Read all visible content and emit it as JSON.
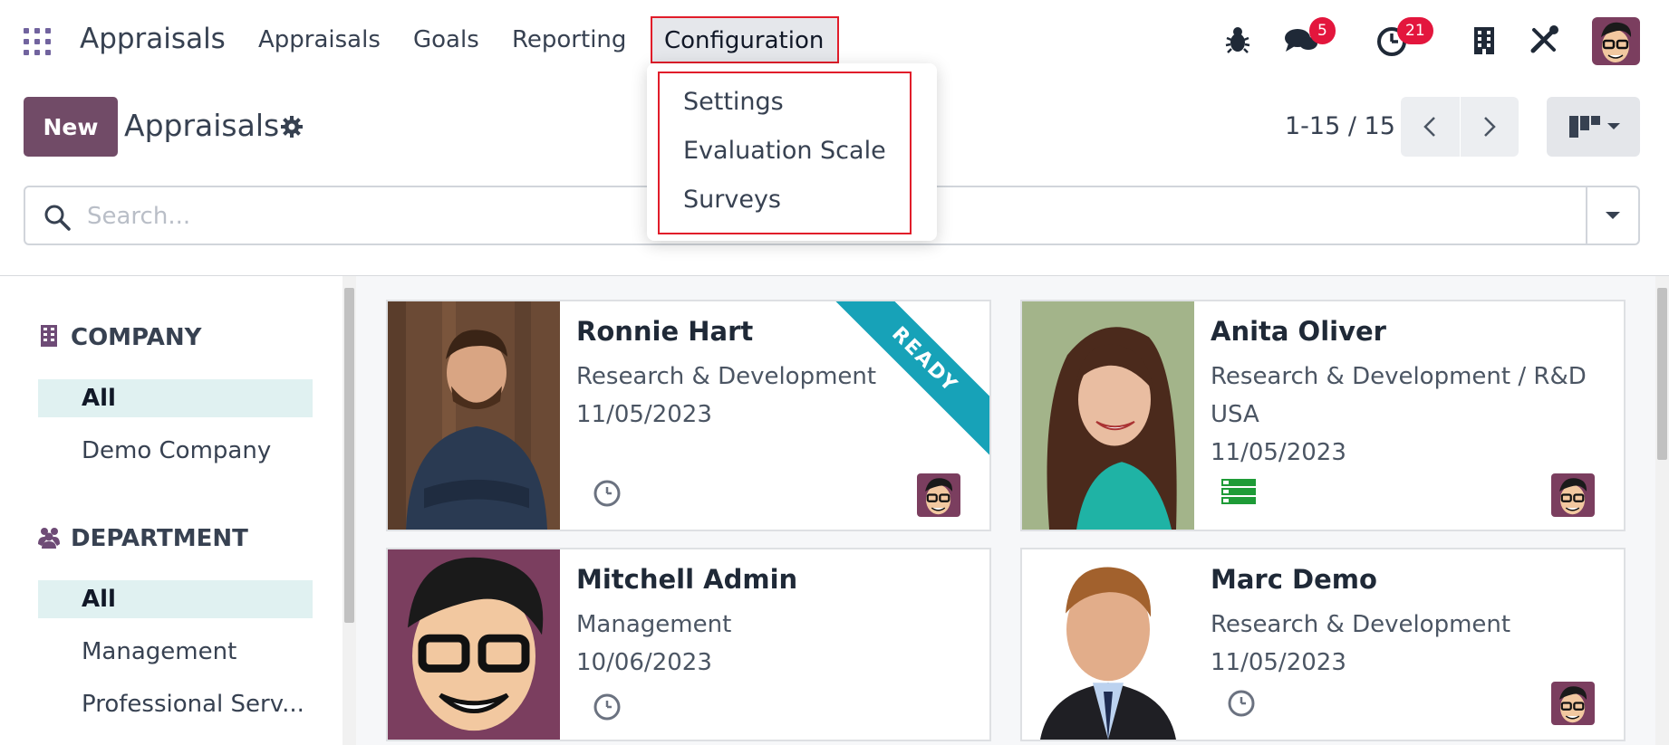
{
  "navbar": {
    "brand": "Appraisals",
    "menu": [
      "Appraisals",
      "Goals",
      "Reporting",
      "Configuration"
    ],
    "messages_badge": "5",
    "activities_badge": "21"
  },
  "control_panel": {
    "new_label": "New",
    "title": "Appraisals",
    "pager": "1-15 / 15"
  },
  "search": {
    "placeholder": "Search..."
  },
  "config_menu": {
    "items": [
      "Settings",
      "Evaluation Scale",
      "Surveys"
    ]
  },
  "sidebar": {
    "company": {
      "heading": "COMPANY",
      "items": [
        "All",
        "Demo Company"
      ]
    },
    "department": {
      "heading": "DEPARTMENT",
      "items": [
        "All",
        "Management",
        "Professional Serv..."
      ]
    }
  },
  "cards": [
    {
      "name": "Ronnie Hart",
      "department": "Research & Development",
      "date": "11/05/2023",
      "ribbon": "READY"
    },
    {
      "name": "Anita Oliver",
      "department": "Research & Development / R&D",
      "department_line2": "USA",
      "date": "11/05/2023"
    },
    {
      "name": "Mitchell Admin",
      "department": "Management",
      "date": "10/06/2023"
    },
    {
      "name": "Marc Demo",
      "department": "Research & Development",
      "date": "11/05/2023"
    }
  ],
  "colors": {
    "brand": "#714b67",
    "badge": "#e3163d",
    "ribbon": "#17a2b8",
    "highlight_box": "#e11d2a",
    "sidebar_active": "#e0f1f1"
  }
}
